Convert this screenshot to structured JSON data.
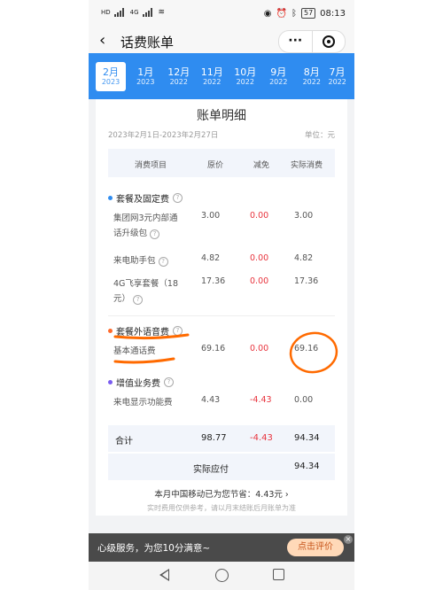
{
  "status_bar": {
    "signal_labels": [
      "HD",
      "4G"
    ],
    "battery": "57",
    "time": "08:13",
    "icons": [
      "eye-icon",
      "alarm-icon",
      "bluetooth-icon"
    ]
  },
  "header": {
    "back_icon": "chevron-left-icon",
    "title": "话费账单",
    "more_label": "···"
  },
  "months": [
    {
      "month": "2月",
      "year": "2023",
      "active": true
    },
    {
      "month": "1月",
      "year": "2023"
    },
    {
      "month": "12月",
      "year": "2022"
    },
    {
      "month": "11月",
      "year": "2022"
    },
    {
      "month": "10月",
      "year": "2022"
    },
    {
      "month": "9月",
      "year": "2022"
    },
    {
      "month": "8月",
      "year": "2022"
    },
    {
      "month": "7月",
      "year": "2022"
    }
  ],
  "bill": {
    "title": "账单明细",
    "period": "2023年2月1日-2023年2月27日",
    "unit": "单位：元",
    "columns": [
      "消费项目",
      "原价",
      "减免",
      "实际消费"
    ],
    "sections": [
      {
        "name": "套餐及固定费",
        "dot_color": "#2f8cf0",
        "rows": [
          {
            "name": "集团网3元内部通话升级包",
            "orig": "3.00",
            "discount": "0.00",
            "actual": "3.00"
          },
          {
            "name": "来电助手包",
            "orig": "4.82",
            "discount": "0.00",
            "actual": "4.82"
          },
          {
            "name": "4G飞享套餐（18元）",
            "orig": "17.36",
            "discount": "0.00",
            "actual": "17.36"
          }
        ]
      },
      {
        "name": "套餐外语音费",
        "dot_color": "#ff6a2b",
        "rows": [
          {
            "name": "基本通话费",
            "orig": "69.16",
            "discount": "0.00",
            "actual": "69.16"
          }
        ]
      },
      {
        "name": "增值业务费",
        "dot_color": "#7a5cf0",
        "rows": [
          {
            "name": "来电显示功能费",
            "orig": "4.43",
            "discount": "-4.43",
            "actual": "0.00"
          }
        ]
      }
    ],
    "total": {
      "label": "合计",
      "orig": "98.77",
      "discount": "-4.43",
      "actual": "94.34"
    },
    "due": {
      "label": "实际应付",
      "value": "94.34"
    },
    "saved_text": "本月中国移动已为您节省：4.43元 ›",
    "note": "实时费用仅供参考，请以月末结账后月账单为准"
  },
  "banner": {
    "text": "心级服务，为您10分满意~",
    "button": "点击评价",
    "close": "×"
  },
  "colors": {
    "accent": "#2f8cf0",
    "discount_red": "#e8333d",
    "annotation_orange": "#ff6a00"
  }
}
